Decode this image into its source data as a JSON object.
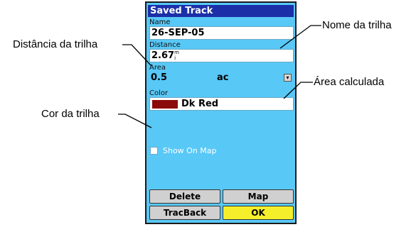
{
  "window": {
    "title": "Saved Track"
  },
  "fields": {
    "name": {
      "label": "Name",
      "value": "26-SEP-05"
    },
    "distance": {
      "label": "Distance",
      "value": "2.67",
      "unit": "m\ni"
    },
    "area": {
      "label": "Area",
      "value": "0.5",
      "unit": "ac"
    },
    "color": {
      "label": "Color",
      "value": "Dk Red",
      "swatch": "#8b0a0a"
    }
  },
  "checkbox": {
    "label": "Show On Map",
    "checked": false
  },
  "buttons": {
    "delete": "Delete",
    "map": "Map",
    "tracback": "TracBack",
    "ok": "OK"
  },
  "callouts": {
    "name": "Nome da trilha",
    "distance": "Distância da trilha",
    "area": "Área calculada",
    "color": "Cor da trilha"
  },
  "colors": {
    "screen_bg": "#58c8f7",
    "titlebar": "#1b2fa8",
    "ok_button": "#f5ef2b"
  }
}
